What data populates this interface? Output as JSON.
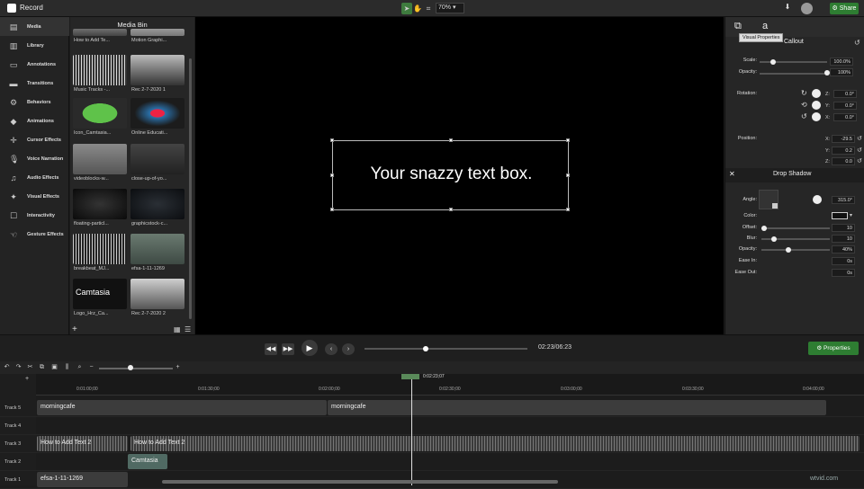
{
  "app": {
    "title": "Record",
    "zoom": "70%",
    "share": "Share"
  },
  "tools": [
    "Media",
    "Library",
    "Annotations",
    "Transitions",
    "Behaviors",
    "Animations",
    "Cursor Effects",
    "Voice Narration",
    "Audio Effects",
    "Visual Effects",
    "Interactivity",
    "Gesture Effects"
  ],
  "bin": {
    "title": "Media Bin",
    "items": [
      "How to Add Te...",
      "Motion Graphi...",
      "Music Tracks -...",
      "Rec 2-7-2020 1",
      "Icon_Camtasia...",
      "Online Educati...",
      "videoblocks-w...",
      "close-up-of-yo...",
      "floating-particl...",
      "graphicstock-c...",
      "breakbeat_MJ...",
      "efsa-1-11-1269",
      "Logo_Hrz_Ca...",
      "Rec 2-7-2020 2"
    ]
  },
  "canvas": {
    "text": "Your snazzy text box."
  },
  "props": {
    "tab_a": "a",
    "tooltip": "Visual Properties",
    "title": "Callout",
    "scale_label": "Scale:",
    "scale": "100.0%",
    "opacity_label": "Opacity:",
    "opacity": "100%",
    "rotation_label": "Rotation:",
    "rz": "0.0°",
    "ry": "0.0°",
    "rx": "0.0°",
    "position_label": "Position:",
    "px": "-29.5",
    "py": "0.2",
    "pz": "0.0",
    "ds_title": "Drop Shadow",
    "angle_label": "Angle:",
    "angle": "315.0°",
    "color_label": "Color:",
    "offset_label": "Offset:",
    "offset": "10",
    "blur_label": "Blur:",
    "blur": "10",
    "ds_opacity_label": "Opacity:",
    "ds_opacity": "40%",
    "easein_label": "Ease In:",
    "easein": "0s",
    "easeout_label": "Ease Out:",
    "easeout": "0s"
  },
  "playback": {
    "time": "02:23/06:23",
    "properties": "Properties"
  },
  "timeline": {
    "playhead": "0:02:23;07",
    "ticks": [
      "0:01:00;00",
      "0:01:30;00",
      "0:02:00;00",
      "0:02:30;00",
      "0:03:00;00",
      "0:03:30;00",
      "0:04:00;00"
    ],
    "tracks": [
      {
        "name": "Track 5"
      },
      {
        "name": "Track 4"
      },
      {
        "name": "Track 3"
      },
      {
        "name": "Track 2"
      },
      {
        "name": "Track 1"
      }
    ],
    "clips": {
      "t5a": "morningcafe",
      "t5b": "morningcafe",
      "t3a": "How to Add Text 2",
      "t3b": "How to Add Text 2",
      "t2a": "Camtasia",
      "t1a": "efsa-1-11-1269"
    }
  },
  "watermark": "wtvid.com",
  "colors": {
    "accent": "#2e7d32",
    "panel": "#262626",
    "canvas": "#000000"
  }
}
